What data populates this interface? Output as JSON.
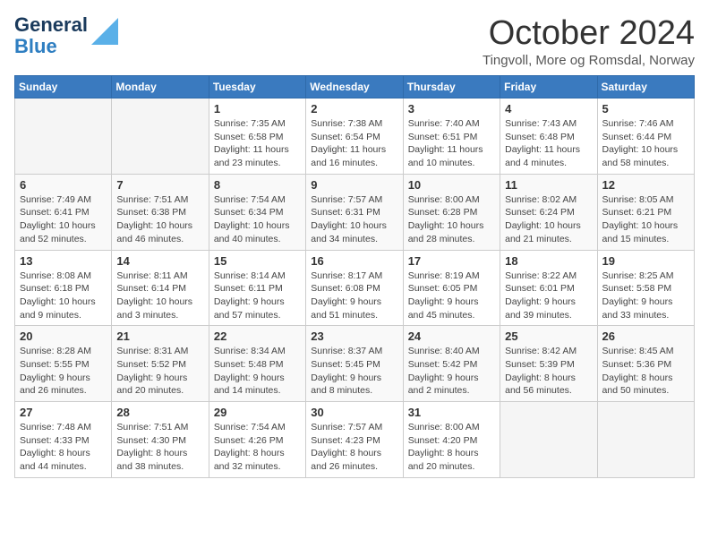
{
  "header": {
    "logo": {
      "line1": "General",
      "line2": "Blue"
    },
    "title": "October 2024",
    "location": "Tingvoll, More og Romsdal, Norway"
  },
  "days_of_week": [
    "Sunday",
    "Monday",
    "Tuesday",
    "Wednesday",
    "Thursday",
    "Friday",
    "Saturday"
  ],
  "weeks": [
    [
      {
        "day": "",
        "info": ""
      },
      {
        "day": "",
        "info": ""
      },
      {
        "day": "1",
        "info": "Sunrise: 7:35 AM\nSunset: 6:58 PM\nDaylight: 11 hours\nand 23 minutes."
      },
      {
        "day": "2",
        "info": "Sunrise: 7:38 AM\nSunset: 6:54 PM\nDaylight: 11 hours\nand 16 minutes."
      },
      {
        "day": "3",
        "info": "Sunrise: 7:40 AM\nSunset: 6:51 PM\nDaylight: 11 hours\nand 10 minutes."
      },
      {
        "day": "4",
        "info": "Sunrise: 7:43 AM\nSunset: 6:48 PM\nDaylight: 11 hours\nand 4 minutes."
      },
      {
        "day": "5",
        "info": "Sunrise: 7:46 AM\nSunset: 6:44 PM\nDaylight: 10 hours\nand 58 minutes."
      }
    ],
    [
      {
        "day": "6",
        "info": "Sunrise: 7:49 AM\nSunset: 6:41 PM\nDaylight: 10 hours\nand 52 minutes."
      },
      {
        "day": "7",
        "info": "Sunrise: 7:51 AM\nSunset: 6:38 PM\nDaylight: 10 hours\nand 46 minutes."
      },
      {
        "day": "8",
        "info": "Sunrise: 7:54 AM\nSunset: 6:34 PM\nDaylight: 10 hours\nand 40 minutes."
      },
      {
        "day": "9",
        "info": "Sunrise: 7:57 AM\nSunset: 6:31 PM\nDaylight: 10 hours\nand 34 minutes."
      },
      {
        "day": "10",
        "info": "Sunrise: 8:00 AM\nSunset: 6:28 PM\nDaylight: 10 hours\nand 28 minutes."
      },
      {
        "day": "11",
        "info": "Sunrise: 8:02 AM\nSunset: 6:24 PM\nDaylight: 10 hours\nand 21 minutes."
      },
      {
        "day": "12",
        "info": "Sunrise: 8:05 AM\nSunset: 6:21 PM\nDaylight: 10 hours\nand 15 minutes."
      }
    ],
    [
      {
        "day": "13",
        "info": "Sunrise: 8:08 AM\nSunset: 6:18 PM\nDaylight: 10 hours\nand 9 minutes."
      },
      {
        "day": "14",
        "info": "Sunrise: 8:11 AM\nSunset: 6:14 PM\nDaylight: 10 hours\nand 3 minutes."
      },
      {
        "day": "15",
        "info": "Sunrise: 8:14 AM\nSunset: 6:11 PM\nDaylight: 9 hours\nand 57 minutes."
      },
      {
        "day": "16",
        "info": "Sunrise: 8:17 AM\nSunset: 6:08 PM\nDaylight: 9 hours\nand 51 minutes."
      },
      {
        "day": "17",
        "info": "Sunrise: 8:19 AM\nSunset: 6:05 PM\nDaylight: 9 hours\nand 45 minutes."
      },
      {
        "day": "18",
        "info": "Sunrise: 8:22 AM\nSunset: 6:01 PM\nDaylight: 9 hours\nand 39 minutes."
      },
      {
        "day": "19",
        "info": "Sunrise: 8:25 AM\nSunset: 5:58 PM\nDaylight: 9 hours\nand 33 minutes."
      }
    ],
    [
      {
        "day": "20",
        "info": "Sunrise: 8:28 AM\nSunset: 5:55 PM\nDaylight: 9 hours\nand 26 minutes."
      },
      {
        "day": "21",
        "info": "Sunrise: 8:31 AM\nSunset: 5:52 PM\nDaylight: 9 hours\nand 20 minutes."
      },
      {
        "day": "22",
        "info": "Sunrise: 8:34 AM\nSunset: 5:48 PM\nDaylight: 9 hours\nand 14 minutes."
      },
      {
        "day": "23",
        "info": "Sunrise: 8:37 AM\nSunset: 5:45 PM\nDaylight: 9 hours\nand 8 minutes."
      },
      {
        "day": "24",
        "info": "Sunrise: 8:40 AM\nSunset: 5:42 PM\nDaylight: 9 hours\nand 2 minutes."
      },
      {
        "day": "25",
        "info": "Sunrise: 8:42 AM\nSunset: 5:39 PM\nDaylight: 8 hours\nand 56 minutes."
      },
      {
        "day": "26",
        "info": "Sunrise: 8:45 AM\nSunset: 5:36 PM\nDaylight: 8 hours\nand 50 minutes."
      }
    ],
    [
      {
        "day": "27",
        "info": "Sunrise: 7:48 AM\nSunset: 4:33 PM\nDaylight: 8 hours\nand 44 minutes."
      },
      {
        "day": "28",
        "info": "Sunrise: 7:51 AM\nSunset: 4:30 PM\nDaylight: 8 hours\nand 38 minutes."
      },
      {
        "day": "29",
        "info": "Sunrise: 7:54 AM\nSunset: 4:26 PM\nDaylight: 8 hours\nand 32 minutes."
      },
      {
        "day": "30",
        "info": "Sunrise: 7:57 AM\nSunset: 4:23 PM\nDaylight: 8 hours\nand 26 minutes."
      },
      {
        "day": "31",
        "info": "Sunrise: 8:00 AM\nSunset: 4:20 PM\nDaylight: 8 hours\nand 20 minutes."
      },
      {
        "day": "",
        "info": ""
      },
      {
        "day": "",
        "info": ""
      }
    ]
  ]
}
